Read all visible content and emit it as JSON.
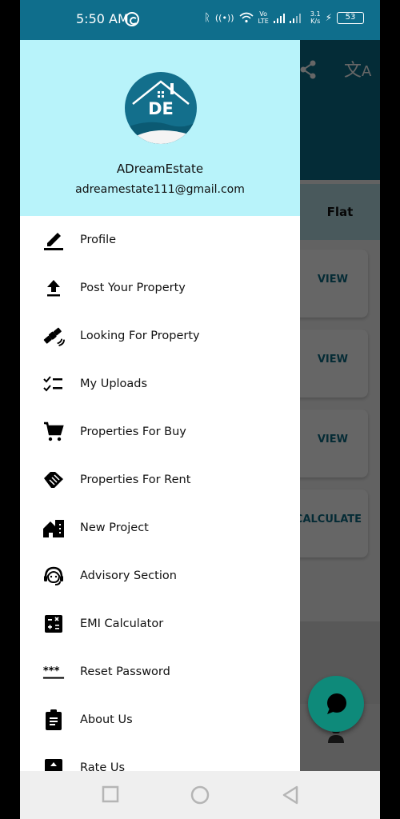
{
  "status_bar": {
    "time": "5:50 AM",
    "net_speed_value": "3.1",
    "net_speed_unit": "K/s",
    "volte_top": "Vo",
    "volte_bottom": "LTE",
    "battery": "53"
  },
  "app_background": {
    "header_icons": [
      "share-icon",
      "translate-icon"
    ],
    "tab_label": "Flat",
    "card_buttons": [
      "VIEW",
      "VIEW",
      "VIEW",
      "CALCULATE"
    ],
    "fab_icon": "chat-icon",
    "bottom_nav_icon": "person-icon"
  },
  "drawer": {
    "brand_name": "ADreamEstate",
    "email": "adreamestate111@gmail.com",
    "logo_text": "DE",
    "items": [
      {
        "label": "Profile",
        "icon": "edit-icon"
      },
      {
        "label": "Post Your Property",
        "icon": "upload-icon"
      },
      {
        "label": "Looking For Property",
        "icon": "satellite-icon"
      },
      {
        "label": "My Uploads",
        "icon": "checklist-icon"
      },
      {
        "label": "Properties For Buy",
        "icon": "cart-icon"
      },
      {
        "label": "Properties For Rent",
        "icon": "handshake-icon"
      },
      {
        "label": "New Project",
        "icon": "building-icon"
      },
      {
        "label": "Advisory Section",
        "icon": "support-agent-icon"
      },
      {
        "label": "EMI Calculator",
        "icon": "calculator-icon"
      },
      {
        "label": "Reset Password",
        "icon": "password-icon"
      },
      {
        "label": "About Us",
        "icon": "clipboard-icon"
      },
      {
        "label": "Rate Us",
        "icon": "rate-icon"
      }
    ]
  },
  "nav_bar": {
    "buttons": [
      "recents",
      "home",
      "back"
    ]
  }
}
